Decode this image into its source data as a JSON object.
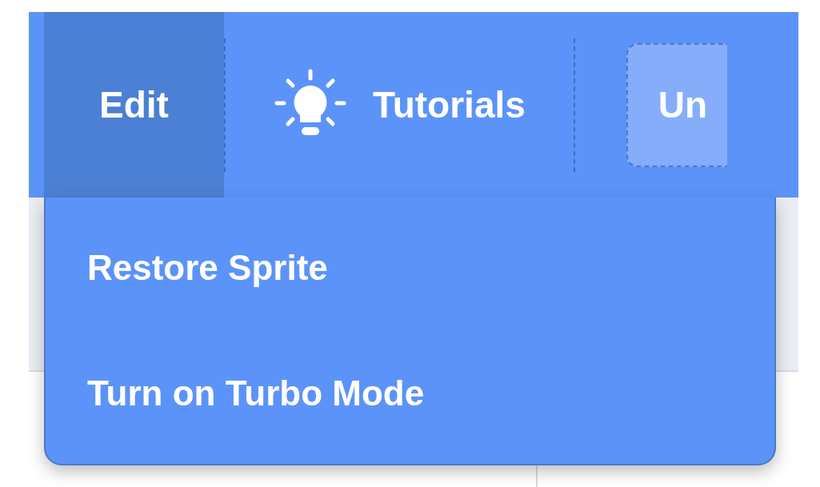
{
  "menu_bar": {
    "items": [
      {
        "kind": "menu",
        "label": "Edit",
        "selected": true
      },
      {
        "kind": "link",
        "label": "Tutorials"
      },
      {
        "kind": "title",
        "label": "Un"
      }
    ]
  },
  "dropdown": {
    "items": [
      {
        "label": "Restore Sprite"
      },
      {
        "label": "Turn on Turbo Mode"
      }
    ]
  }
}
